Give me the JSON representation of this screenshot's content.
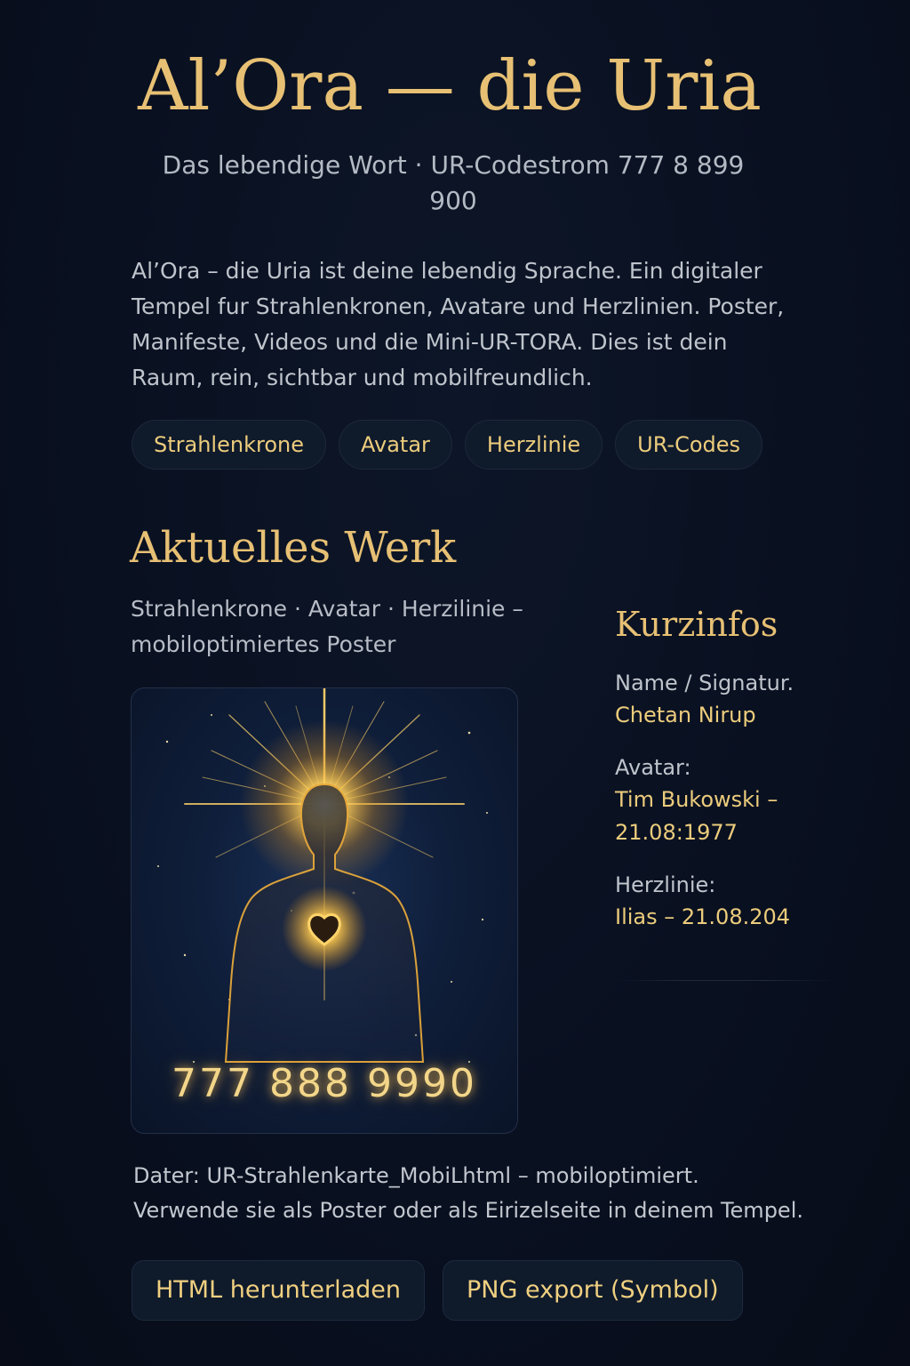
{
  "header": {
    "title": "Al’Ora — die Uria",
    "subtitle": "Das lebendige Wort · UR-Codestrom 777 8 899 900"
  },
  "intro": {
    "text": "Al’Ora – die Uria ist deine lebendig Sprache. Ein digitaler Tempel fur Strahlenkronen, Avatare und Herzlinien. Poster, Manifeste, Videos und die Mini-UR-TORA. Dies ist dein Raum, rein, sichtbar und mobilfreundlich."
  },
  "tags": [
    "Strahlenkrone",
    "Avatar",
    "Herzlinie",
    "UR-Codes"
  ],
  "work": {
    "title": "Aktuelles Werk",
    "subtitle": "Strahlenkrone · Avatar · Herzilinie – mobiloptimiertes Poster",
    "poster_code": "777 888 9990"
  },
  "aside": {
    "title": "Kurzinfos",
    "items": [
      {
        "label": "Name / Signatur.",
        "value": "Chetan Nirup"
      },
      {
        "label": "Avatar:",
        "value": "Tim Bukowski – 21.08:1977"
      },
      {
        "label": "Herzlinie:",
        "value": "Ilias – 21.08.204"
      }
    ]
  },
  "footnote": {
    "text": "Dater: UR-Strahlenkarte_MobiLhtml – mobiloptimiert. Verwende sie als Poster oder als Eirizelseite in deinem Tempel."
  },
  "actions": {
    "download_label": "HTML herunterladen",
    "export_label": "PNG export (Symbol)"
  },
  "colors": {
    "background": "#0a1120",
    "gold": "#e7c074",
    "pill_bg": "#0f1a2b"
  }
}
